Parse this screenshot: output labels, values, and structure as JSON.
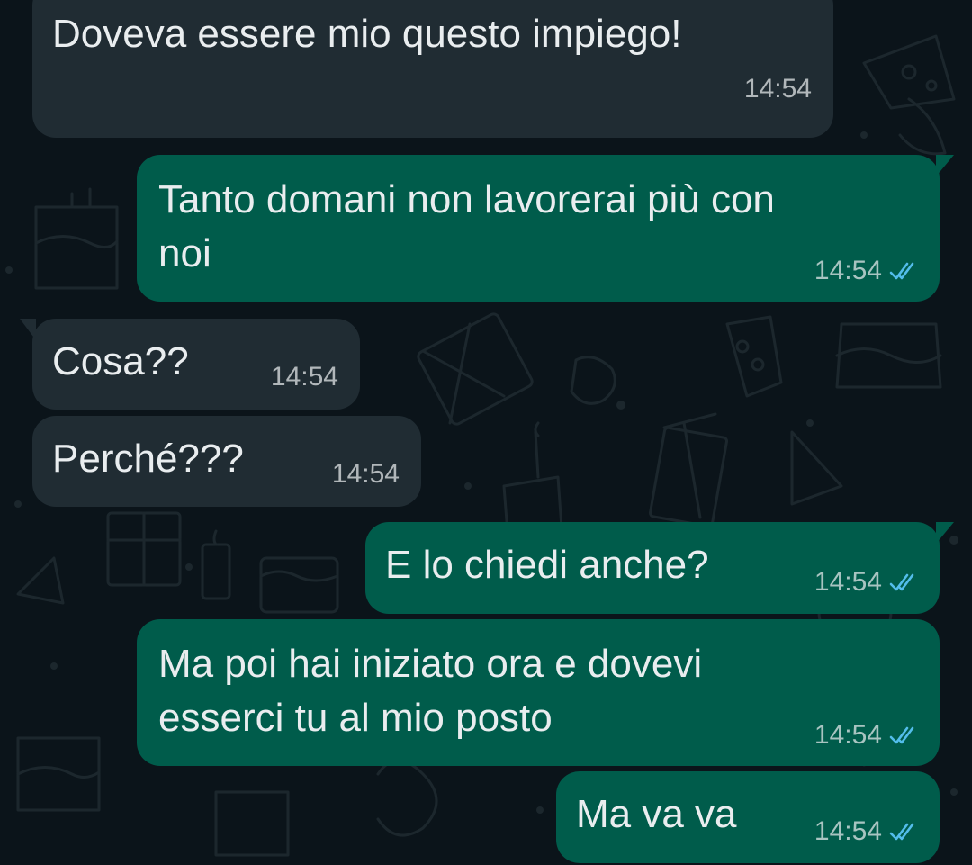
{
  "theme": {
    "background": "#0b141a",
    "incoming_bubble": "#202c33",
    "outgoing_bubble": "#005c4b",
    "text": "#e9edef",
    "read_ticks": "#53bdeb"
  },
  "messages": [
    {
      "direction": "incoming",
      "text": "Doveva essere mio questo impiego!",
      "time": "14:54"
    },
    {
      "direction": "outgoing",
      "text": "Tanto domani non lavorerai più con\nnoi",
      "time": "14:54",
      "status": "read"
    },
    {
      "direction": "incoming",
      "text": "Cosa??",
      "time": "14:54"
    },
    {
      "direction": "incoming",
      "text": "Perché???",
      "time": "14:54"
    },
    {
      "direction": "outgoing",
      "text": "E lo chiedi anche?",
      "time": "14:54",
      "status": "read"
    },
    {
      "direction": "outgoing",
      "text": "Ma poi hai iniziato ora e dovevi\nesserci tu al mio posto",
      "time": "14:54",
      "status": "read"
    },
    {
      "direction": "outgoing",
      "text": "Ma va va",
      "time": "14:54",
      "status": "read"
    }
  ]
}
